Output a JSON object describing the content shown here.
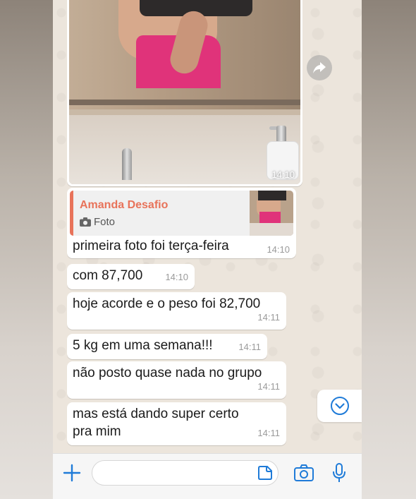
{
  "chat": {
    "photo_time": "14:10",
    "reply": {
      "author": "Amanda Desafio",
      "kind": "Foto",
      "text": "primeira foto foi terça-feira",
      "time": "14:10"
    },
    "messages": [
      {
        "text": "com 87,700",
        "time": "14:10"
      },
      {
        "text": "hoje acorde e o peso foi 82,700",
        "time": "14:11"
      },
      {
        "text": "5 kg em uma semana!!!",
        "time": "14:11"
      },
      {
        "text": "não posto quase nada no grupo",
        "time": "14:11"
      },
      {
        "text": "mas está dando super certo pra mim",
        "time": "14:11"
      }
    ]
  },
  "input": {
    "placeholder": ""
  },
  "colors": {
    "quote_accent": "#e8735a",
    "accent_blue": "#1f7bd8"
  },
  "icons": [
    "forward-icon",
    "camera-small-icon",
    "chevron-down-icon",
    "plus-icon",
    "sticker-icon",
    "camera-icon",
    "mic-icon"
  ]
}
